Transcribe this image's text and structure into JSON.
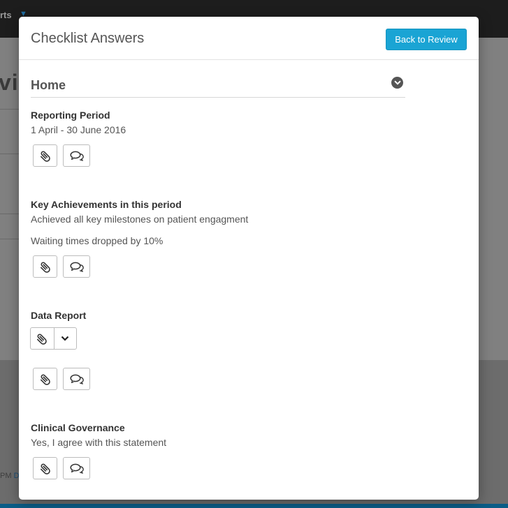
{
  "background": {
    "nav_text": "rts",
    "title_fragment": "vic",
    "footer_text": "PM",
    "footer_link": "De"
  },
  "modal": {
    "title": "Checklist Answers",
    "back_button_label": "Back to Review",
    "section_title": "Home",
    "questions": [
      {
        "label": "Reporting Period",
        "answers": [
          "1 April - 30 June 2016"
        ]
      },
      {
        "label": "Key Achievements in this period",
        "answers": [
          "Achieved all key milestones on patient engagment",
          "Waiting times dropped by 10%"
        ]
      },
      {
        "label": "Data Report",
        "answers": []
      },
      {
        "label": "Clinical Governance",
        "answers": [
          "Yes, I agree with this statement"
        ]
      }
    ]
  },
  "icons": {
    "attach": "paperclip-icon",
    "comment": "comments-icon",
    "expand": "chevron-down-icon",
    "section_toggle": "chevron-circle-down-icon"
  },
  "colors": {
    "primary_button": "#1aa4d4",
    "topbar": "#1d1d1d"
  }
}
